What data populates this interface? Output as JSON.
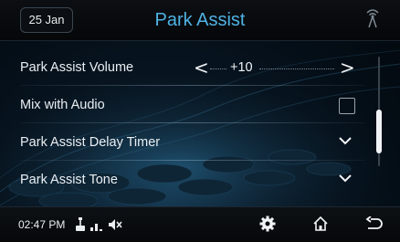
{
  "header": {
    "date": "25 Jan",
    "title": "Park Assist"
  },
  "settings": {
    "volume": {
      "label": "Park Assist Volume",
      "value": "+10"
    },
    "mix_audio": {
      "label": "Mix with Audio",
      "checked": false
    },
    "delay_timer": {
      "label": "Park Assist Delay Timer"
    },
    "tone": {
      "label": "Park Assist Tone"
    }
  },
  "scroll": {
    "position_fraction": 0.45
  },
  "statusbar": {
    "time": "02:47 PM",
    "icons": [
      "usb-icon",
      "signal-bars-icon",
      "mute-icon"
    ]
  },
  "nav": {
    "icons": [
      "settings-gear-icon",
      "home-icon",
      "back-icon"
    ]
  },
  "colors": {
    "title": "#4fb3e5",
    "text": "#e9eef2",
    "background": "#05101a"
  }
}
